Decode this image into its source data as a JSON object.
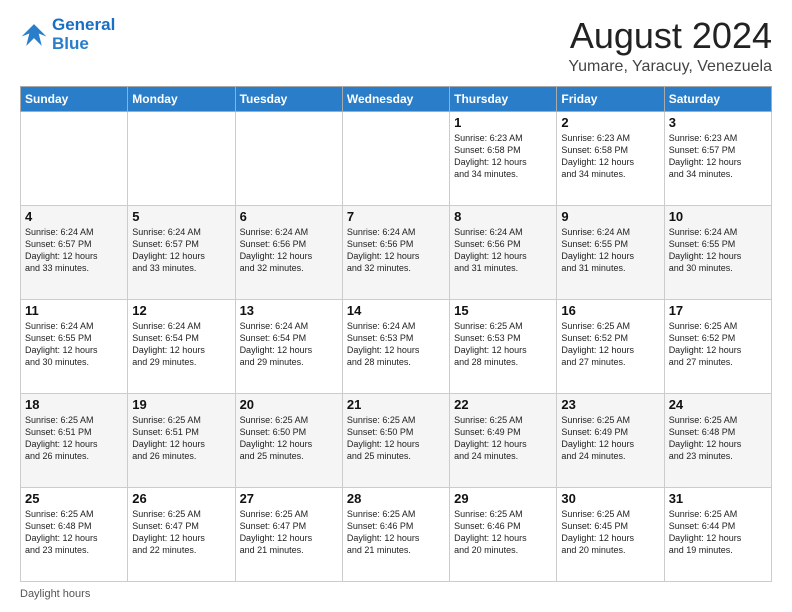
{
  "header": {
    "logo_line1": "General",
    "logo_line2": "Blue",
    "month": "August 2024",
    "location": "Yumare, Yaracuy, Venezuela"
  },
  "days_of_week": [
    "Sunday",
    "Monday",
    "Tuesday",
    "Wednesday",
    "Thursday",
    "Friday",
    "Saturday"
  ],
  "weeks": [
    [
      {
        "day": "",
        "info": ""
      },
      {
        "day": "",
        "info": ""
      },
      {
        "day": "",
        "info": ""
      },
      {
        "day": "",
        "info": ""
      },
      {
        "day": "1",
        "info": "Sunrise: 6:23 AM\nSunset: 6:58 PM\nDaylight: 12 hours\nand 34 minutes."
      },
      {
        "day": "2",
        "info": "Sunrise: 6:23 AM\nSunset: 6:58 PM\nDaylight: 12 hours\nand 34 minutes."
      },
      {
        "day": "3",
        "info": "Sunrise: 6:23 AM\nSunset: 6:57 PM\nDaylight: 12 hours\nand 34 minutes."
      }
    ],
    [
      {
        "day": "4",
        "info": "Sunrise: 6:24 AM\nSunset: 6:57 PM\nDaylight: 12 hours\nand 33 minutes."
      },
      {
        "day": "5",
        "info": "Sunrise: 6:24 AM\nSunset: 6:57 PM\nDaylight: 12 hours\nand 33 minutes."
      },
      {
        "day": "6",
        "info": "Sunrise: 6:24 AM\nSunset: 6:56 PM\nDaylight: 12 hours\nand 32 minutes."
      },
      {
        "day": "7",
        "info": "Sunrise: 6:24 AM\nSunset: 6:56 PM\nDaylight: 12 hours\nand 32 minutes."
      },
      {
        "day": "8",
        "info": "Sunrise: 6:24 AM\nSunset: 6:56 PM\nDaylight: 12 hours\nand 31 minutes."
      },
      {
        "day": "9",
        "info": "Sunrise: 6:24 AM\nSunset: 6:55 PM\nDaylight: 12 hours\nand 31 minutes."
      },
      {
        "day": "10",
        "info": "Sunrise: 6:24 AM\nSunset: 6:55 PM\nDaylight: 12 hours\nand 30 minutes."
      }
    ],
    [
      {
        "day": "11",
        "info": "Sunrise: 6:24 AM\nSunset: 6:55 PM\nDaylight: 12 hours\nand 30 minutes."
      },
      {
        "day": "12",
        "info": "Sunrise: 6:24 AM\nSunset: 6:54 PM\nDaylight: 12 hours\nand 29 minutes."
      },
      {
        "day": "13",
        "info": "Sunrise: 6:24 AM\nSunset: 6:54 PM\nDaylight: 12 hours\nand 29 minutes."
      },
      {
        "day": "14",
        "info": "Sunrise: 6:24 AM\nSunset: 6:53 PM\nDaylight: 12 hours\nand 28 minutes."
      },
      {
        "day": "15",
        "info": "Sunrise: 6:25 AM\nSunset: 6:53 PM\nDaylight: 12 hours\nand 28 minutes."
      },
      {
        "day": "16",
        "info": "Sunrise: 6:25 AM\nSunset: 6:52 PM\nDaylight: 12 hours\nand 27 minutes."
      },
      {
        "day": "17",
        "info": "Sunrise: 6:25 AM\nSunset: 6:52 PM\nDaylight: 12 hours\nand 27 minutes."
      }
    ],
    [
      {
        "day": "18",
        "info": "Sunrise: 6:25 AM\nSunset: 6:51 PM\nDaylight: 12 hours\nand 26 minutes."
      },
      {
        "day": "19",
        "info": "Sunrise: 6:25 AM\nSunset: 6:51 PM\nDaylight: 12 hours\nand 26 minutes."
      },
      {
        "day": "20",
        "info": "Sunrise: 6:25 AM\nSunset: 6:50 PM\nDaylight: 12 hours\nand 25 minutes."
      },
      {
        "day": "21",
        "info": "Sunrise: 6:25 AM\nSunset: 6:50 PM\nDaylight: 12 hours\nand 25 minutes."
      },
      {
        "day": "22",
        "info": "Sunrise: 6:25 AM\nSunset: 6:49 PM\nDaylight: 12 hours\nand 24 minutes."
      },
      {
        "day": "23",
        "info": "Sunrise: 6:25 AM\nSunset: 6:49 PM\nDaylight: 12 hours\nand 24 minutes."
      },
      {
        "day": "24",
        "info": "Sunrise: 6:25 AM\nSunset: 6:48 PM\nDaylight: 12 hours\nand 23 minutes."
      }
    ],
    [
      {
        "day": "25",
        "info": "Sunrise: 6:25 AM\nSunset: 6:48 PM\nDaylight: 12 hours\nand 23 minutes."
      },
      {
        "day": "26",
        "info": "Sunrise: 6:25 AM\nSunset: 6:47 PM\nDaylight: 12 hours\nand 22 minutes."
      },
      {
        "day": "27",
        "info": "Sunrise: 6:25 AM\nSunset: 6:47 PM\nDaylight: 12 hours\nand 21 minutes."
      },
      {
        "day": "28",
        "info": "Sunrise: 6:25 AM\nSunset: 6:46 PM\nDaylight: 12 hours\nand 21 minutes."
      },
      {
        "day": "29",
        "info": "Sunrise: 6:25 AM\nSunset: 6:46 PM\nDaylight: 12 hours\nand 20 minutes."
      },
      {
        "day": "30",
        "info": "Sunrise: 6:25 AM\nSunset: 6:45 PM\nDaylight: 12 hours\nand 20 minutes."
      },
      {
        "day": "31",
        "info": "Sunrise: 6:25 AM\nSunset: 6:44 PM\nDaylight: 12 hours\nand 19 minutes."
      }
    ]
  ],
  "footer": {
    "label": "Daylight hours"
  }
}
